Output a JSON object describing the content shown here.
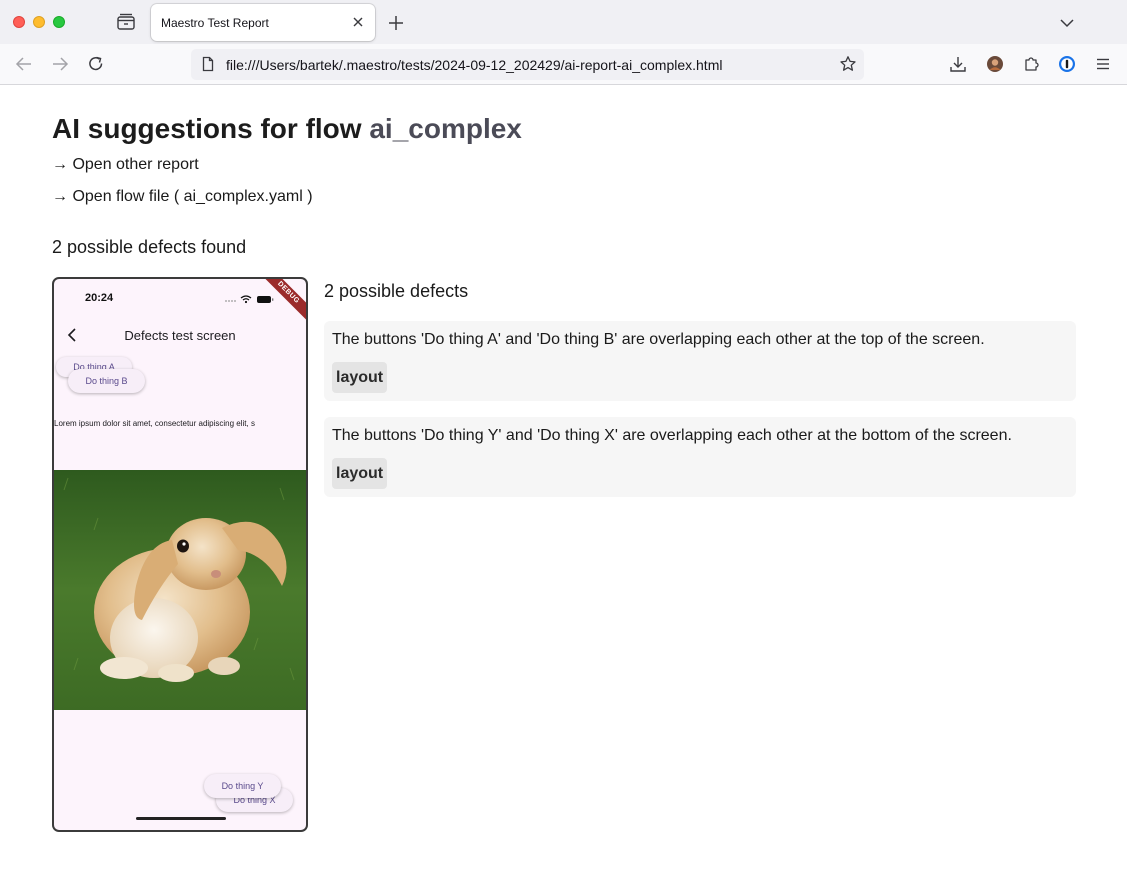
{
  "browser": {
    "tab_title": "Maestro Test Report",
    "url": "file:///Users/bartek/.maestro/tests/2024-09-12_202429/ai-report-ai_complex.html"
  },
  "page": {
    "title_prefix": "AI suggestions for flow ",
    "flow_name": "ai_complex",
    "open_other_report": "→ Open other report",
    "open_flow_file": "→ Open flow file ( ai_complex.yaml )",
    "defects_found": "2 possible defects found"
  },
  "screenshot": {
    "time": "20:24",
    "debug_label": "DEBUG",
    "screen_title": "Defects test screen",
    "button_a": "Do thing A",
    "button_b": "Do thing B",
    "lorem": "Lorem ipsum dolor sit amet, consectetur adipiscing elit, s",
    "button_x": "Do thing X",
    "button_y": "Do thing Y"
  },
  "defects_panel": {
    "heading": "2 possible defects",
    "items": [
      {
        "text": "The buttons 'Do thing A' and 'Do thing B' are overlapping each other at the top of the screen.",
        "category": "layout"
      },
      {
        "text": "The buttons 'Do thing Y' and 'Do thing X' are overlapping each other at the bottom of the screen.",
        "category": "layout"
      }
    ]
  },
  "colors": {
    "close": "#ff5f57",
    "minimize": "#febc2e",
    "zoom": "#28c840",
    "card_background": "#f6f6f6",
    "flow_name": "#4b4b57"
  }
}
